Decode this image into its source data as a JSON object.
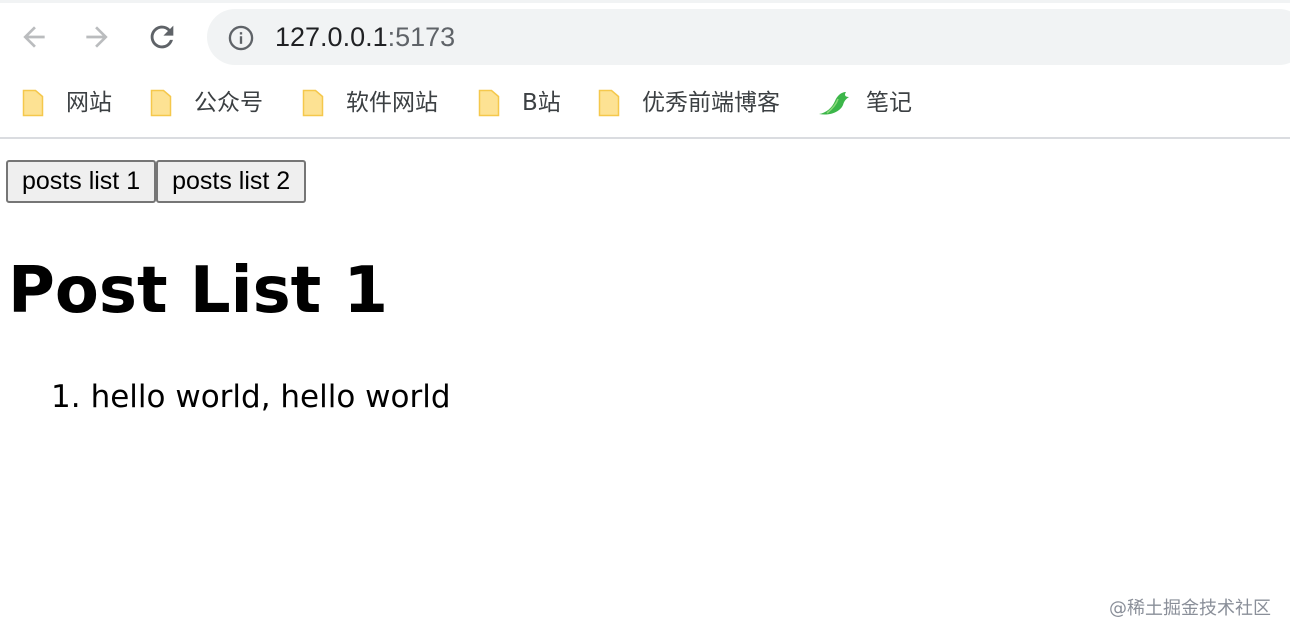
{
  "browser": {
    "url_host": "127.0.0.1",
    "url_port": ":5173",
    "icons": {
      "back": "arrow-left-icon",
      "forward": "arrow-right-icon",
      "reload": "reload-icon",
      "site_info": "info-icon"
    }
  },
  "bookmarks": [
    {
      "label": "网站",
      "icon": "folder-icon"
    },
    {
      "label": "公众号",
      "icon": "folder-icon"
    },
    {
      "label": "软件网站",
      "icon": "folder-icon"
    },
    {
      "label": "B站",
      "icon": "folder-icon"
    },
    {
      "label": "优秀前端博客",
      "icon": "folder-icon"
    },
    {
      "label": "笔记",
      "icon": "bird-icon"
    }
  ],
  "colors": {
    "folder_fill": "#fde293",
    "folder_stroke": "#f5c84c",
    "bird_green": "#3cb64a"
  },
  "page": {
    "buttons": [
      "posts list 1",
      "posts list 2"
    ],
    "title": "Post List 1",
    "posts": [
      {
        "number": "1.",
        "text": "hello world, hello world"
      }
    ]
  },
  "watermark": "@稀土掘金技术社区"
}
